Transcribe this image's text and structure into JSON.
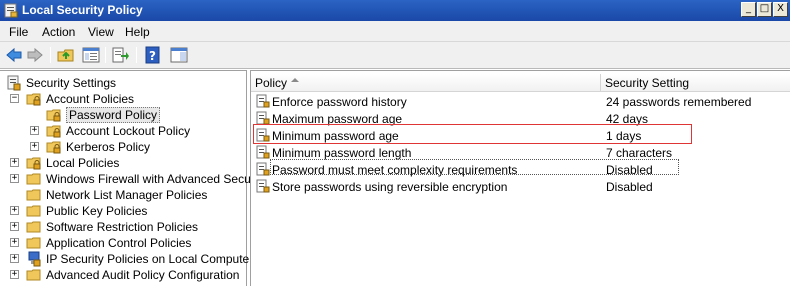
{
  "window": {
    "title": "Local Security Policy",
    "buttons": [
      "_",
      "□",
      "X"
    ]
  },
  "menu": [
    "File",
    "Action",
    "View",
    "Help"
  ],
  "toolbar": {
    "icons": [
      "back-arrow-icon",
      "forward-arrow-icon",
      "up-folder-icon",
      "show-hide-tree-icon",
      "export-list-icon",
      "help-icon"
    ]
  },
  "tree": [
    {
      "label": "Security Settings",
      "level": 0,
      "expander": "",
      "icon": "security-settings-icon"
    },
    {
      "label": "Account Policies",
      "level": 1,
      "expander": "−",
      "icon": "folder-lock-icon"
    },
    {
      "label": "Password Policy",
      "level": 2,
      "expander": "",
      "icon": "folder-lock-icon",
      "selected": true
    },
    {
      "label": "Account Lockout Policy",
      "level": 2,
      "expander": "+",
      "icon": "folder-lock-icon"
    },
    {
      "label": "Kerberos Policy",
      "level": 2,
      "expander": "+",
      "icon": "folder-lock-icon"
    },
    {
      "label": "Local Policies",
      "level": 1,
      "expander": "+",
      "icon": "folder-lock-icon"
    },
    {
      "label": "Windows Firewall with Advanced Security",
      "level": 1,
      "expander": "+",
      "icon": "folder-icon"
    },
    {
      "label": "Network List Manager Policies",
      "level": 1,
      "expander": "",
      "icon": "folder-icon"
    },
    {
      "label": "Public Key Policies",
      "level": 1,
      "expander": "+",
      "icon": "folder-icon"
    },
    {
      "label": "Software Restriction Policies",
      "level": 1,
      "expander": "+",
      "icon": "folder-icon"
    },
    {
      "label": "Application Control Policies",
      "level": 1,
      "expander": "+",
      "icon": "folder-icon"
    },
    {
      "label": "IP Security Policies on Local Computer",
      "level": 1,
      "expander": "+",
      "icon": "ip-security-icon"
    },
    {
      "label": "Advanced Audit Policy Configuration",
      "level": 1,
      "expander": "+",
      "icon": "folder-icon"
    }
  ],
  "list": {
    "columns": [
      "Policy",
      "Security Setting"
    ],
    "rows": [
      {
        "policy": "Enforce password history",
        "setting": "24 passwords remembered"
      },
      {
        "policy": "Maximum password age",
        "setting": "42 days"
      },
      {
        "policy": "Minimum password age",
        "setting": "1 days"
      },
      {
        "policy": "Minimum password length",
        "setting": "7 characters"
      },
      {
        "policy": "Password must meet complexity requirements",
        "setting": "Disabled"
      },
      {
        "policy": "Store passwords using reversible encryption",
        "setting": "Disabled"
      }
    ]
  },
  "colors": {
    "titlebar": "#2b64c4",
    "highlight": "#e03535",
    "folder": "#f0c75a"
  }
}
